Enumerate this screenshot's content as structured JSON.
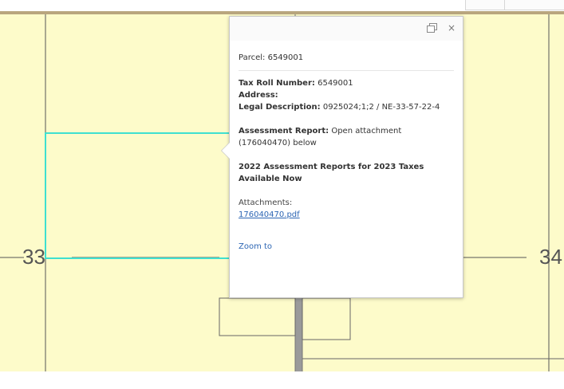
{
  "map": {
    "township_left": "33",
    "township_right": "34",
    "colors": {
      "land": "#fdfbca",
      "road": "#b9a67e",
      "section_line": "#555555",
      "selected_parcel": "#3fe0d0"
    }
  },
  "popup": {
    "icons": [
      "dock-icon",
      "close-icon"
    ],
    "close_glyph": "×",
    "title": "Parcel: 6549001",
    "tax_roll_label": "Tax Roll Number:",
    "tax_roll_value": "6549001",
    "address_label": "Address:",
    "address_value": "",
    "legal_label": "Legal Description:",
    "legal_value": "0925024;1;2 / NE-33-57-22-4",
    "assessment_label": "Assessment Report:",
    "assessment_value": "Open attachment (176040470) below",
    "notice": "2022 Assessment Reports for 2023 Taxes Available Now",
    "attachments_label": "Attachments:",
    "attachment_file": "176040470.pdf",
    "zoom_to": "Zoom to"
  }
}
